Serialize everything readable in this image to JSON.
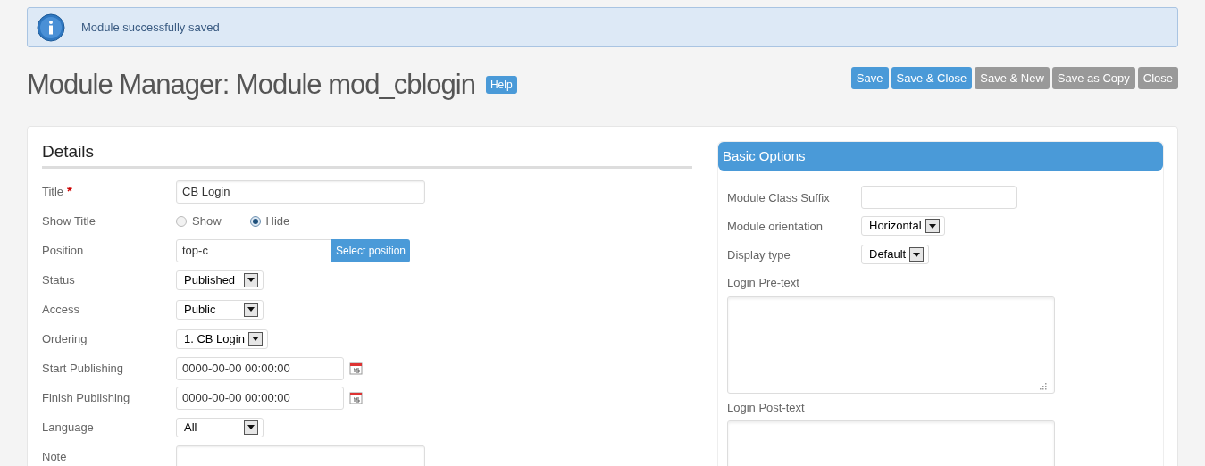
{
  "alert": {
    "message": "Module successfully saved"
  },
  "header": {
    "title": "Module Manager: Module mod_cblogin",
    "help": "Help"
  },
  "toolbar": [
    {
      "label": "Save",
      "kind": "primary"
    },
    {
      "label": "Save & Close",
      "kind": "primary"
    },
    {
      "label": "Save & New",
      "kind": "default"
    },
    {
      "label": "Save as Copy",
      "kind": "default"
    },
    {
      "label": "Close",
      "kind": "default"
    }
  ],
  "details": {
    "heading": "Details",
    "fields": [
      {
        "kind": "text",
        "label": "Title",
        "required_mark": "*",
        "value": "CB Login"
      },
      {
        "kind": "radio",
        "label": "Show Title",
        "options": [
          {
            "label": "Show",
            "selected": false
          },
          {
            "label": "Hide",
            "selected": true
          }
        ]
      },
      {
        "kind": "text_button",
        "label": "Position",
        "value": "top-c",
        "button": "Select position"
      },
      {
        "kind": "select",
        "label": "Status",
        "value": "Published"
      },
      {
        "kind": "select",
        "label": "Access",
        "value": "Public"
      },
      {
        "kind": "select",
        "label": "Ordering",
        "value": "1. CB Login"
      },
      {
        "kind": "date",
        "label": "Start Publishing",
        "value": "0000-00-00 00:00:00"
      },
      {
        "kind": "date",
        "label": "Finish Publishing",
        "value": "0000-00-00 00:00:00"
      },
      {
        "kind": "select",
        "label": "Language",
        "value": "All"
      },
      {
        "kind": "text",
        "label": "Note"
      }
    ]
  },
  "basic_options": {
    "heading": "Basic Options",
    "fields": [
      {
        "kind": "text",
        "label": "Module Class Suffix"
      },
      {
        "kind": "select",
        "label": "Module orientation",
        "value": "Horizontal"
      },
      {
        "kind": "select",
        "label": "Display type",
        "value": "Default"
      },
      {
        "kind": "textarea",
        "label": "Login Pre-text"
      },
      {
        "kind": "textarea",
        "label": "Login Post-text"
      }
    ]
  }
}
